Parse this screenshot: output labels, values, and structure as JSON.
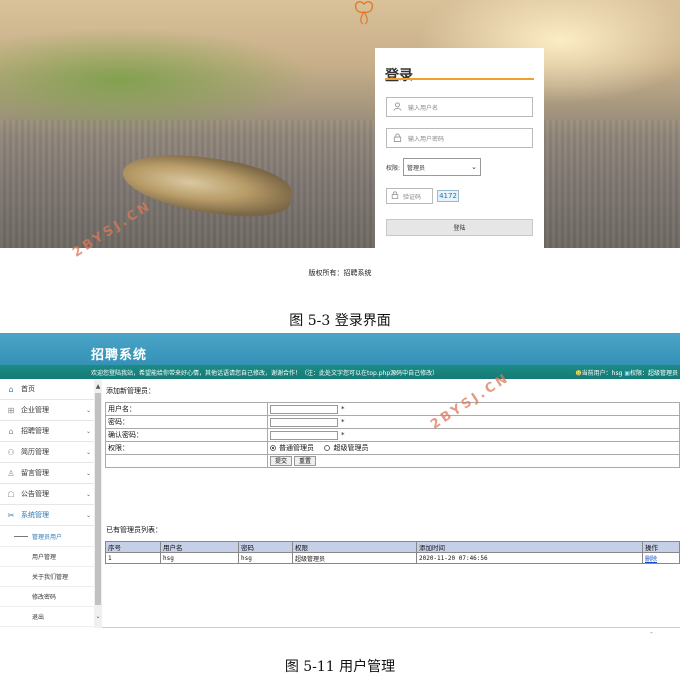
{
  "figure1": {
    "login": {
      "title": "登录",
      "username_placeholder": "输入用户名",
      "password_placeholder": "输入用户密码",
      "role_label": "权限:",
      "role_selected": "管理员",
      "captcha_placeholder": "验证码",
      "captcha_code": "4172",
      "submit_label": "登陆"
    },
    "copyright": "版权所有：招聘系统",
    "caption": "图 5-3 登录界面"
  },
  "watermark": "2BYSJ.CN",
  "figure2": {
    "header": {
      "app_title": "招聘系统",
      "welcome": "欢迎您登陆我站，希望能给你带来好心情，其他话语请您自己修改，谢谢合作！（注：此处文字您可以在top.php源码中自己修改）",
      "user_info": "当前用户：hsg",
      "role_info": "权限：超级管理员"
    },
    "sidebar": {
      "items": [
        {
          "label": "首页",
          "icon": "home-icon"
        },
        {
          "label": "企业管理",
          "icon": "grid-icon"
        },
        {
          "label": "招聘管理",
          "icon": "home-icon"
        },
        {
          "label": "简历管理",
          "icon": "people-icon"
        },
        {
          "label": "留言管理",
          "icon": "user-icon"
        },
        {
          "label": "公告管理",
          "icon": "chat-icon"
        },
        {
          "label": "系统管理",
          "icon": "tools-icon"
        }
      ],
      "subitems": [
        "管理员用户",
        "用户管理",
        "关于我们管理",
        "修改密码",
        "退出"
      ]
    },
    "main": {
      "add_title": "添加新管理员：",
      "form": {
        "username_label": "用户名：",
        "password_label": "密码：",
        "confirm_label": "确认密码：",
        "role_label": "权限：",
        "required_mark": "*",
        "role_options": [
          "普通管理员",
          "超级管理员"
        ],
        "submit_label": "提交",
        "reset_label": "重置"
      },
      "list_title": "已有管理员列表：",
      "table": {
        "headers": [
          "序号",
          "用户名",
          "密码",
          "权限",
          "添加时间",
          "操作"
        ],
        "rows": [
          {
            "id": "1",
            "username": "hsg",
            "password": "hsg",
            "role": "超级管理员",
            "time": "2020-11-20 07:46:56",
            "action": "删除"
          }
        ]
      }
    },
    "caption": "图 5-11 用户管理"
  },
  "colors": {
    "topbar": "#3591b6",
    "noticebar": "#157a75",
    "accent_orange": "#f0a030",
    "table_header": "#c5cfe8",
    "watermark": "#dc785a"
  }
}
